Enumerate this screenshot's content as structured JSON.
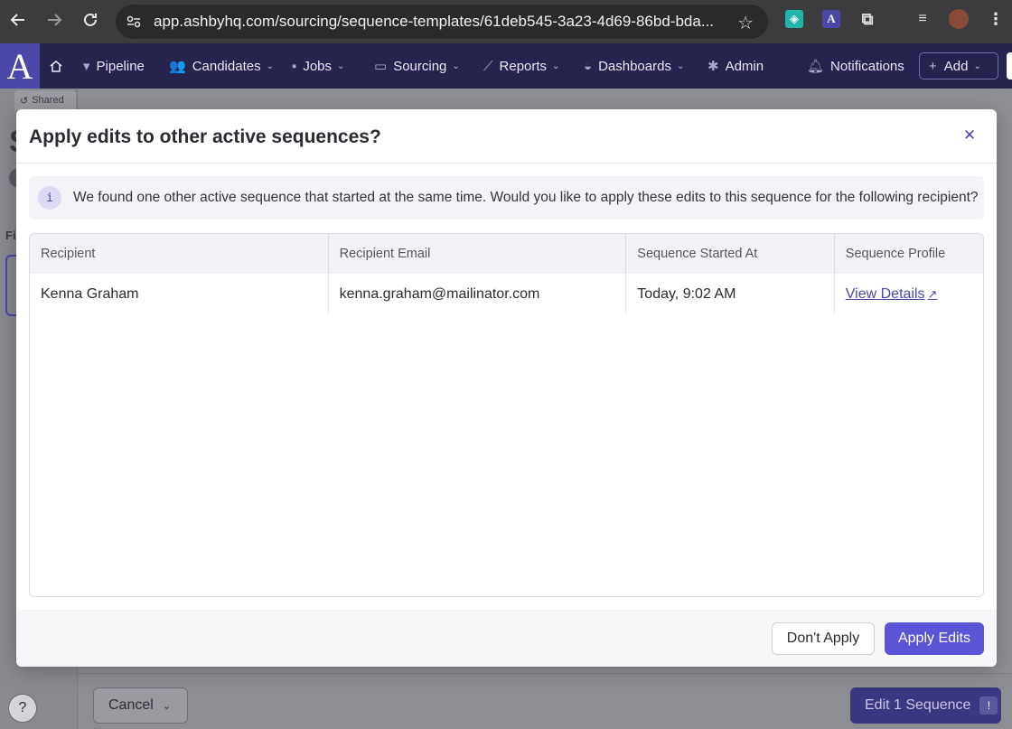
{
  "browser": {
    "url": "app.ashbyhq.com/sourcing/sequence-templates/61deb545-3a23-4d69-86bd-bda...",
    "ext_a_label": "A"
  },
  "nav": {
    "logo": "A",
    "items": [
      {
        "label": "Pipeline",
        "icon": "filter-icon"
      },
      {
        "label": "Candidates",
        "icon": "people-icon"
      },
      {
        "label": "Jobs",
        "icon": "briefcase-icon"
      },
      {
        "label": "Sourcing",
        "icon": "sourcing-icon"
      },
      {
        "label": "Reports",
        "icon": "chart-icon"
      },
      {
        "label": "Dashboards",
        "icon": "gauge-icon"
      },
      {
        "label": "Admin",
        "icon": "gear-icon"
      },
      {
        "label": "Notifications",
        "icon": "bell-icon"
      }
    ],
    "add_label": "Add"
  },
  "background": {
    "shared_tab": "Shared",
    "cancel_label": "Cancel",
    "edit_sequence_label": "Edit 1 Sequence",
    "edit_sequence_badge": "!",
    "help_label": "?"
  },
  "modal": {
    "title": "Apply edits to other active sequences?",
    "info_icon": "i",
    "info_text": "We found one other active sequence that started at the same time. Would you like to apply these edits to this sequence for the following recipient?",
    "columns": [
      "Recipient",
      "Recipient Email",
      "Sequence Started At",
      "Sequence Profile"
    ],
    "rows": [
      {
        "recipient": "Kenna Graham",
        "email": "kenna.graham@mailinator.com",
        "started_at": "Today, 9:02 AM",
        "profile_link": "View Details"
      }
    ],
    "dont_apply_label": "Don't Apply",
    "apply_label": "Apply Edits"
  },
  "colors": {
    "brand": "#4b47a8",
    "nav_bg": "#26234e",
    "primary_button": "#5b54d6"
  }
}
